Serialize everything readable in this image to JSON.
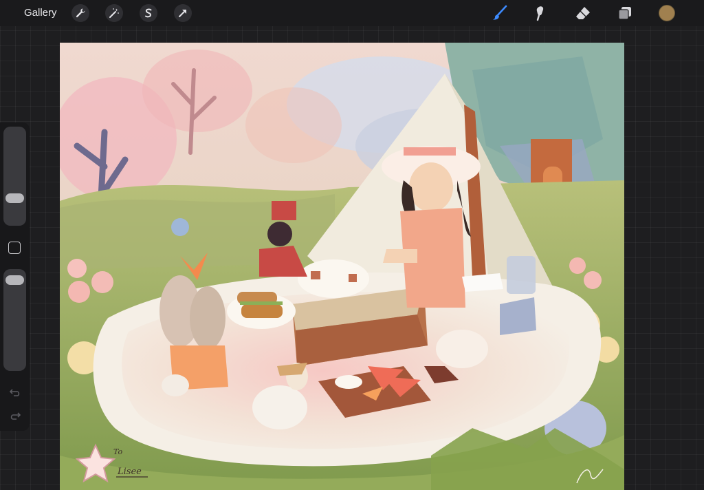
{
  "topbar": {
    "gallery_label": "Gallery",
    "left_tools": [
      "wrench-icon",
      "magic-wand-icon",
      "selection-icon",
      "transform-arrow-icon"
    ],
    "right_tools": [
      "brush-icon",
      "smudge-icon",
      "eraser-icon",
      "layers-icon"
    ],
    "active_tool": "brush",
    "accent_color": "#3d8bff",
    "current_color": "#a0804f"
  },
  "sidebar": {
    "brush_size_level": 0.24,
    "opacity_level": 0.95,
    "modify_button": "square-modify-icon",
    "undo": "undo-icon",
    "redo": "redo-icon"
  },
  "canvas": {
    "artwork": "picnic-illustration",
    "signature_text": "Lisee",
    "signature_prefix": "To"
  }
}
